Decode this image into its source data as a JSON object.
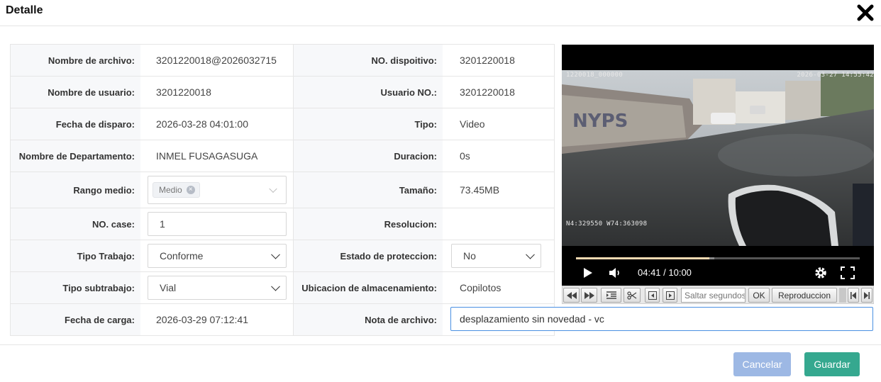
{
  "dialog": {
    "title": "Detalle",
    "close_icon": "close-icon"
  },
  "fields": {
    "nombre_archivo": {
      "label": "Nombre de archivo:",
      "value": "3201220018@2026032715"
    },
    "no_dispositivo": {
      "label": "NO. dispoitivo:",
      "value": "3201220018"
    },
    "nombre_usuario": {
      "label": "Nombre de usuario:",
      "value": "3201220018"
    },
    "usuario_no": {
      "label": "Usuario NO.:",
      "value": "3201220018"
    },
    "fecha_disparo": {
      "label": "Fecha de disparo:",
      "value": "2026-03-28 04:01:00"
    },
    "tipo": {
      "label": "Tipo:",
      "value": "Video"
    },
    "departamento": {
      "label": "Nombre de Departamento:",
      "value": "INMEL FUSAGASUGA"
    },
    "duracion": {
      "label": "Duracion:",
      "value": "0s"
    },
    "rango_medio": {
      "label": "Rango medio:",
      "tag": "Medio"
    },
    "tamano": {
      "label": "Tamaño:",
      "value": "73.45MB"
    },
    "no_case": {
      "label": "NO. case:",
      "value": "1"
    },
    "resolucion": {
      "label": "Resolucion:",
      "value": ""
    },
    "tipo_trabajo": {
      "label": "Tipo Trabajo:",
      "value": "Conforme"
    },
    "estado_proteccion": {
      "label": "Estado de proteccion:",
      "value": "No"
    },
    "tipo_subtrabajo": {
      "label": "Tipo subtrabajo:",
      "value": "Vial"
    },
    "ubicacion": {
      "label": "Ubicacion de almacenamiento:",
      "value": "Copilotos"
    },
    "fecha_carga": {
      "label": "Fecha de carga:",
      "value": "2026-03-29 07:12:41"
    },
    "nota": {
      "label": "Nota de archivo:",
      "value": "desplazamiento sin novedad - vc"
    }
  },
  "video": {
    "osd_top_left": "1220018_000000",
    "osd_top_right": "2026-03-27  14:55:42",
    "osd_coords": "N4:329550  W74:363098",
    "time_display": "04:41 / 10:00",
    "progress_fraction": 0.47
  },
  "controls": {
    "seek_placeholder": "Saltar segundos",
    "ok_label": "OK",
    "playback_label": "Reproduccion"
  },
  "footer": {
    "cancel_label": "Cancelar",
    "save_label": "Guardar"
  },
  "colors": {
    "cancel_bg": "#9db8e4",
    "save_bg": "#35a88f",
    "note_border": "#4a90e2",
    "progress": "#f3d9b1"
  }
}
